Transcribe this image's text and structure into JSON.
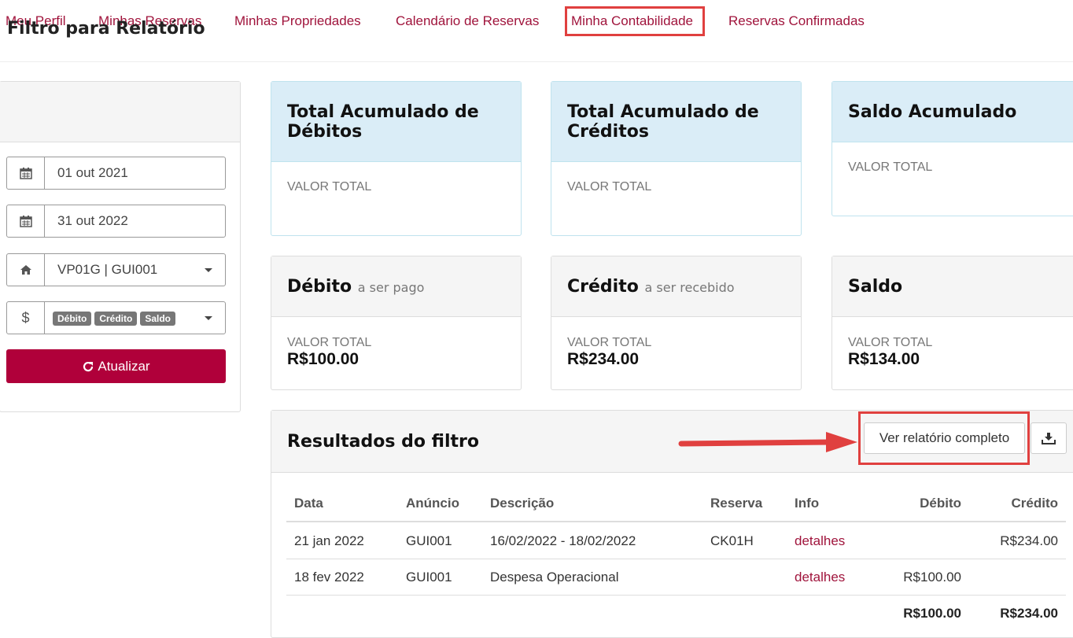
{
  "nav": {
    "items": [
      "Meu Perfil",
      "Minhas Reservas",
      "Minhas Propriedades",
      "Calendário de Reservas",
      "Minha Contabilidade",
      "Reservas Confirmadas"
    ]
  },
  "filter": {
    "title": "Filtro para Relatório",
    "date_from": "01 out 2021",
    "date_to": "31 out 2022",
    "property": "VP01G | GUI001",
    "types": [
      "Débito",
      "Crédito",
      "Saldo"
    ],
    "update_label": "Atualizar"
  },
  "summary": {
    "total_debits": {
      "title": "Total Acumulado de Débitos",
      "label": "VALOR TOTAL"
    },
    "total_credits": {
      "title": "Total Acumulado de Créditos",
      "label": "VALOR TOTAL"
    },
    "total_balance": {
      "title": "Saldo Acumulado",
      "label": "VALOR TOTAL"
    },
    "debit": {
      "title": "Débito",
      "subtitle": "a ser pago",
      "label": "VALOR TOTAL",
      "value": "R$100.00"
    },
    "credit": {
      "title": "Crédito",
      "subtitle": "a ser recebido",
      "label": "VALOR TOTAL",
      "value": "R$234.00"
    },
    "balance": {
      "title": "Saldo",
      "label": "VALOR TOTAL",
      "value": "R$134.00"
    }
  },
  "results": {
    "title": "Resultados do filtro",
    "report_button": "Ver relatório completo",
    "columns": [
      "Data",
      "Anúncio",
      "Descrição",
      "Reserva",
      "Info",
      "Débito",
      "Crédito"
    ],
    "rows": [
      {
        "date": "21 jan 2022",
        "listing": "GUI001",
        "description": "16/02/2022 - 18/02/2022",
        "reservation": "CK01H",
        "info": "detalhes",
        "debit": "",
        "credit": "R$234.00"
      },
      {
        "date": "18 fev 2022",
        "listing": "GUI001",
        "description": "Despesa Operacional",
        "reservation": "",
        "info": "detalhes",
        "debit": "R$100.00",
        "credit": ""
      }
    ],
    "totals": {
      "debit": "R$100.00",
      "credit": "R$234.00"
    }
  },
  "colors": {
    "brand": "#a0143c",
    "button": "#b0003a",
    "highlight": "#e0403f"
  },
  "icons": [
    "calendar-icon",
    "home-icon",
    "dollar-icon",
    "refresh-icon",
    "download-icon",
    "arrow-right-icon"
  ]
}
